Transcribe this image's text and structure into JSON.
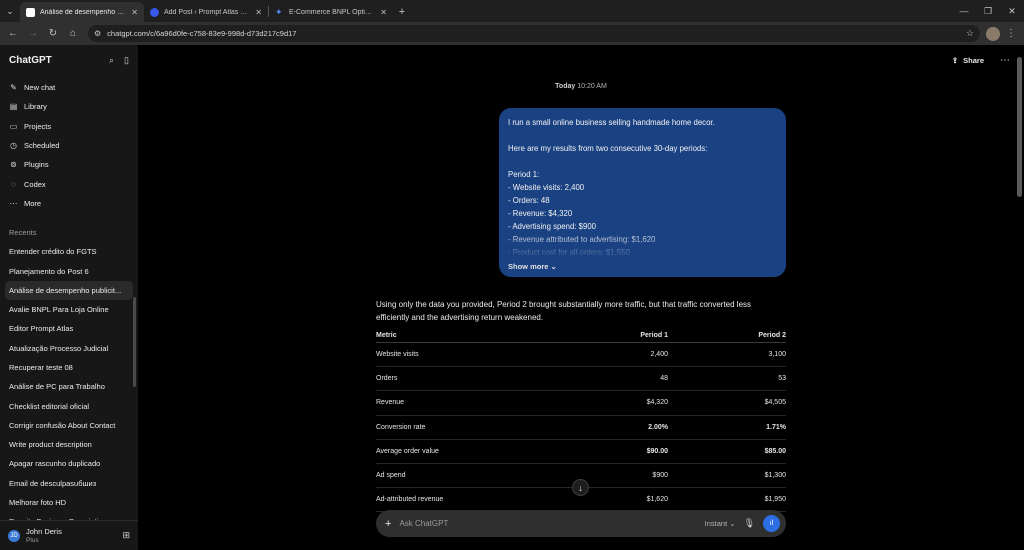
{
  "browser": {
    "tabs": [
      {
        "label": "Análise de desempenho publicitário",
        "active": true,
        "color": "#ffffff"
      },
      {
        "label": "Add Post ‹ Prompt Atlas — Wo",
        "active": false,
        "color": "#3858e9"
      },
      {
        "label": "E-Commerce BNPL Options for",
        "active": false,
        "color": "#4a8af4"
      }
    ],
    "url": "chatgpt.com/c/6a96d0fe-c758-83e9-998d-d73d217c9d17"
  },
  "sidebar": {
    "logo": "ChatGPT",
    "nav": [
      {
        "label": "New chat",
        "icon": "compose-icon"
      },
      {
        "label": "Library",
        "icon": "library-icon"
      },
      {
        "label": "Projects",
        "icon": "folder-icon"
      },
      {
        "label": "Scheduled",
        "icon": "clock-icon"
      },
      {
        "label": "Plugins",
        "icon": "plugin-icon"
      },
      {
        "label": "Codex",
        "icon": "codex-icon"
      },
      {
        "label": "More",
        "icon": "more-icon"
      }
    ],
    "recents_title": "Recents",
    "recents": [
      "Entender crédito do FGTS",
      "Planejamento do Post 6",
      "Análise de desempenho publicit...",
      "Avalie BNPL Para Loja Online",
      "Editor Prompt Atlas",
      "Atualização Processo Judicial",
      "Recuperar teste 08",
      "Análise de PC para Trabalho",
      "Checklist editorial oficial",
      "Corrigir confusão About Contact",
      "Write product description",
      "Apagar rascunho duplicado",
      "Email de desculpasuбшиз",
      "Melhorar foto HD",
      "Rewrite Business Description"
    ],
    "active_recent": 2,
    "user": {
      "name": "John Deris",
      "plan": "Plus",
      "initial": "JD"
    }
  },
  "main": {
    "share_label": "Share",
    "timestamp_day": "Today",
    "timestamp_time": "10:20 AM",
    "user_message": [
      "I run a small online business selling handmade home decor.",
      "",
      "Here are my results from two consecutive 30-day periods:",
      "",
      "Period 1:",
      "- Website visits: 2,400",
      "- Orders: 48",
      "- Revenue: $4,320",
      "- Advertising spend: $900",
      "- Revenue attributed to advertising: $1,620",
      "- Product cost for all orders: $1,550"
    ],
    "show_more": "Show more",
    "answer_intro": "Using only the data you provided, Period 2 brought substantially more traffic, but that traffic converted less efficiently and the advertising return weakened.",
    "table": {
      "headers": [
        "Metric",
        "Period 1",
        "Period 2"
      ],
      "rows": [
        {
          "metric": "Website visits",
          "p1": "2,400",
          "p2": "3,100",
          "bold": false
        },
        {
          "metric": "Orders",
          "p1": "48",
          "p2": "53",
          "bold": false
        },
        {
          "metric": "Revenue",
          "p1": "$4,320",
          "p2": "$4,505",
          "bold": false
        },
        {
          "metric": "Conversion rate",
          "p1": "2.00%",
          "p2": "1.71%",
          "bold": true
        },
        {
          "metric": "Average order value",
          "p1": "$90.00",
          "p2": "$85.00",
          "bold": true
        },
        {
          "metric": "Ad spend",
          "p1": "$900",
          "p2": "$1,300",
          "bold": false
        },
        {
          "metric": "Ad-attributed revenue",
          "p1": "$1,620",
          "p2": "$1,950",
          "bold": false
        }
      ]
    },
    "composer": {
      "placeholder": "Ask ChatGPT",
      "model": "Instant"
    }
  }
}
